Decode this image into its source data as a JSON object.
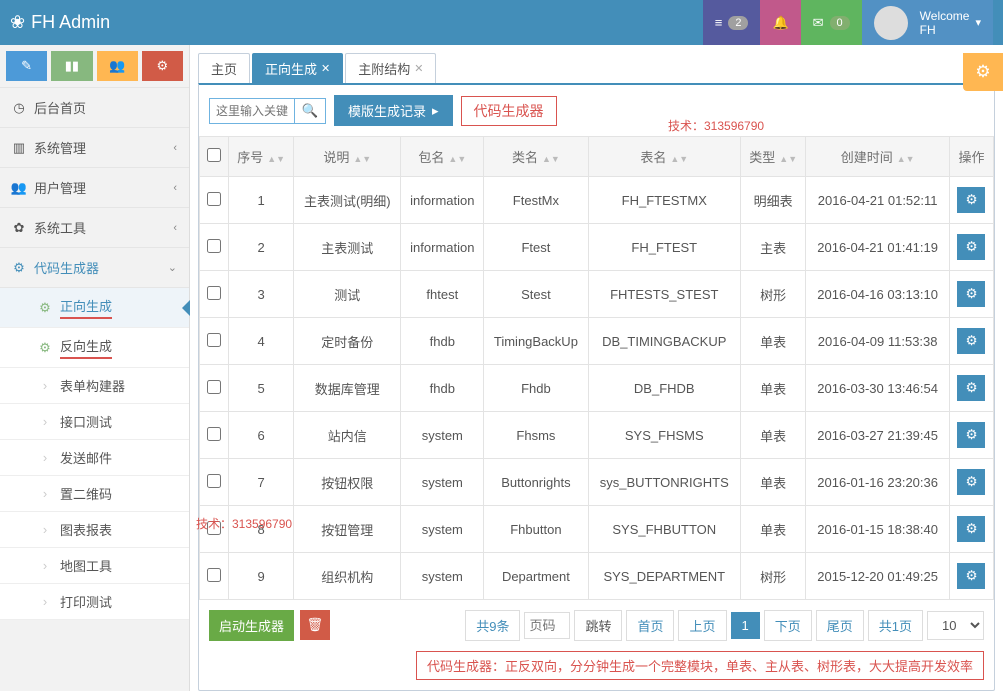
{
  "header": {
    "brand": "FH Admin",
    "list_badge": "2",
    "mail_badge": "0",
    "welcome_label": "Welcome",
    "welcome_user": "FH"
  },
  "sidebar": {
    "items": [
      {
        "icon": "◷",
        "label": "后台首页",
        "expandable": false
      },
      {
        "icon": "▥",
        "label": "系统管理",
        "expandable": true
      },
      {
        "icon": "👥",
        "label": "用户管理",
        "expandable": true
      },
      {
        "icon": "✿",
        "label": "系统工具",
        "expandable": true
      },
      {
        "icon": "⚙",
        "label": "代码生成器",
        "expandable": true,
        "active": true
      }
    ],
    "code_sub": [
      {
        "icon": "⚙",
        "label": "正向生成",
        "active": true,
        "underline": true
      },
      {
        "icon": "⚙",
        "label": "反向生成",
        "underline": true
      },
      {
        "icon": "",
        "label": "表单构建器"
      },
      {
        "icon": "",
        "label": "接口测试"
      },
      {
        "icon": "",
        "label": "发送邮件"
      },
      {
        "icon": "",
        "label": "置二维码"
      },
      {
        "icon": "",
        "label": "图表报表"
      },
      {
        "icon": "",
        "label": "地图工具"
      },
      {
        "icon": "",
        "label": "打印测试"
      }
    ]
  },
  "tabs": [
    {
      "label": "主页",
      "closable": false
    },
    {
      "label": "正向生成",
      "closable": true,
      "active": true
    },
    {
      "label": "主附结构",
      "closable": true
    }
  ],
  "toolbar": {
    "search_placeholder": "这里输入关键",
    "template_history": "模版生成记录",
    "generator_title": "代码生成器"
  },
  "columns": {
    "seq": "序号",
    "desc": "说明",
    "pkg": "包名",
    "cls": "类名",
    "tbl": "表名",
    "type": "类型",
    "created": "创建时间",
    "action": "操作"
  },
  "rows": [
    {
      "seq": "1",
      "desc": "主表测试(明细)",
      "pkg": "information",
      "cls": "FtestMx",
      "tbl": "FH_FTESTMX",
      "type": "明细表",
      "created": "2016-04-21 01:52:11"
    },
    {
      "seq": "2",
      "desc": "主表测试",
      "pkg": "information",
      "cls": "Ftest",
      "tbl": "FH_FTEST",
      "type": "主表",
      "created": "2016-04-21 01:41:19"
    },
    {
      "seq": "3",
      "desc": "测试",
      "pkg": "fhtest",
      "cls": "Stest",
      "tbl": "FHTESTS_STEST",
      "type": "树形",
      "created": "2016-04-16 03:13:10"
    },
    {
      "seq": "4",
      "desc": "定时备份",
      "pkg": "fhdb",
      "cls": "TimingBackUp",
      "tbl": "DB_TIMINGBACKUP",
      "type": "单表",
      "created": "2016-04-09 11:53:38"
    },
    {
      "seq": "5",
      "desc": "数据库管理",
      "pkg": "fhdb",
      "cls": "Fhdb",
      "tbl": "DB_FHDB",
      "type": "单表",
      "created": "2016-03-30 13:46:54"
    },
    {
      "seq": "6",
      "desc": "站内信",
      "pkg": "system",
      "cls": "Fhsms",
      "tbl": "SYS_FHSMS",
      "type": "单表",
      "created": "2016-03-27 21:39:45"
    },
    {
      "seq": "7",
      "desc": "按钮权限",
      "pkg": "system",
      "cls": "Buttonrights",
      "tbl": "sys_BUTTONRIGHTS",
      "type": "单表",
      "created": "2016-01-16 23:20:36"
    },
    {
      "seq": "8",
      "desc": "按钮管理",
      "pkg": "system",
      "cls": "Fhbutton",
      "tbl": "SYS_FHBUTTON",
      "type": "单表",
      "created": "2016-01-15 18:38:40"
    },
    {
      "seq": "9",
      "desc": "组织机构",
      "pkg": "system",
      "cls": "Department",
      "tbl": "SYS_DEPARTMENT",
      "type": "树形",
      "created": "2015-12-20 01:49:25"
    }
  ],
  "footer": {
    "start_btn": "启动生成器",
    "total_label": "共9条",
    "page_input_ph": "页码",
    "jump": "跳转",
    "first": "首页",
    "prev": "上页",
    "current": "1",
    "next": "下页",
    "last": "尾页",
    "pages": "共1页",
    "pagesize": "10"
  },
  "promo": "代码生成器：正反双向，分分钟生成一个完整模块，单表、主从表、树形表，大大提高开发效率",
  "overlays": {
    "watermark": "技术：313596790"
  }
}
